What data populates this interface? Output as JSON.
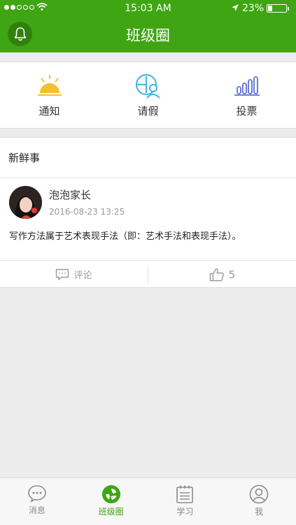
{
  "status_bar": {
    "time": "15:03 AM",
    "battery": "23%"
  },
  "header": {
    "title": "班级圈"
  },
  "actions": [
    {
      "label": "通知",
      "icon": "sunrise-icon"
    },
    {
      "label": "请假",
      "icon": "calendar-person-icon"
    },
    {
      "label": "投票",
      "icon": "bar-chart-icon"
    }
  ],
  "feed": {
    "title": "新鲜事",
    "post": {
      "author": "泡泡家长",
      "time": "2016-08-23 13:25",
      "content": "写作方法属于艺术表现手法（即：艺术手法和表现手法）。",
      "comment_label": "评论",
      "like_count": "5"
    }
  },
  "tabbar": [
    {
      "label": "消息",
      "icon": "chat-bubble-icon"
    },
    {
      "label": "班级圈",
      "icon": "camera-aperture-icon",
      "active": true
    },
    {
      "label": "学习",
      "icon": "notebook-icon"
    },
    {
      "label": "我",
      "icon": "person-icon"
    }
  ],
  "colors": {
    "brand": "#3fa513",
    "notice": "#f5c02e",
    "leave": "#40b4d8",
    "vote": "#5b6fd6"
  }
}
